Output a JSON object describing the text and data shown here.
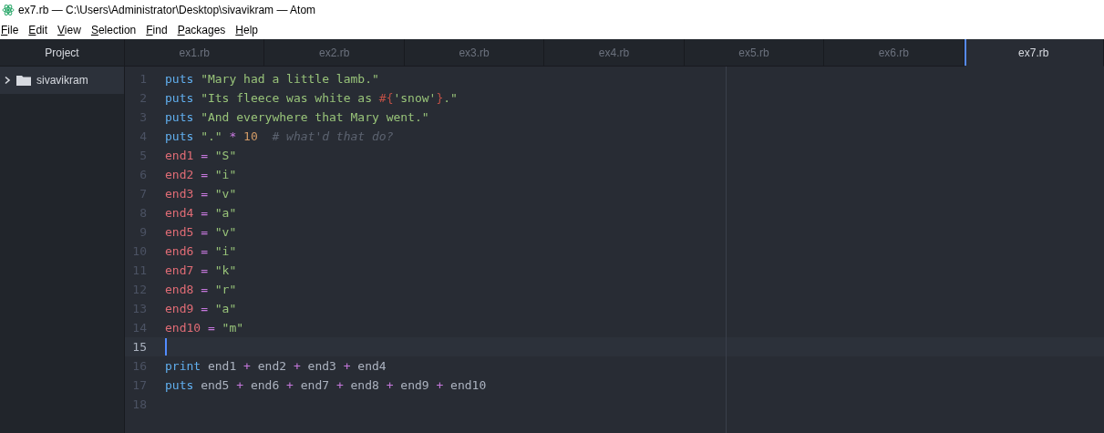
{
  "window": {
    "title": "ex7.rb — C:\\Users\\Administrator\\Desktop\\sivavikram — Atom"
  },
  "menu": [
    "File",
    "Edit",
    "View",
    "Selection",
    "Find",
    "Packages",
    "Help"
  ],
  "sidebar": {
    "title": "Project",
    "items": [
      {
        "label": "sivavikram",
        "expanded": false,
        "selected": true
      }
    ]
  },
  "tabs": [
    {
      "label": "ex1.rb",
      "selected": false
    },
    {
      "label": "ex2.rb",
      "selected": false
    },
    {
      "label": "ex3.rb",
      "selected": false
    },
    {
      "label": "ex4.rb",
      "selected": false
    },
    {
      "label": "ex5.rb",
      "selected": false
    },
    {
      "label": "ex6.rb",
      "selected": false
    },
    {
      "label": "ex7.rb",
      "selected": true
    }
  ],
  "editor": {
    "lines": [
      {
        "number": "1",
        "current": false,
        "tokens": [
          {
            "kind": "keyword",
            "text": "puts"
          },
          {
            "kind": "string",
            "text": " \"Mary had a little lamb.\""
          }
        ]
      },
      {
        "number": "2",
        "current": false,
        "tokens": [
          {
            "kind": "keyword",
            "text": "puts"
          },
          {
            "kind": "string",
            "text": " \"Its fleece was white as "
          },
          {
            "kind": "interp",
            "text": "#{"
          },
          {
            "kind": "string",
            "text": "'snow'"
          },
          {
            "kind": "interp",
            "text": "}"
          },
          {
            "kind": "string",
            "text": ".\""
          }
        ]
      },
      {
        "number": "3",
        "current": false,
        "tokens": [
          {
            "kind": "keyword",
            "text": "puts"
          },
          {
            "kind": "string",
            "text": " \"And everywhere that Mary went.\""
          }
        ]
      },
      {
        "number": "4",
        "current": false,
        "tokens": [
          {
            "kind": "keyword",
            "text": "puts"
          },
          {
            "kind": "string",
            "text": " \".\""
          },
          {
            "kind": "operator",
            "text": " *"
          },
          {
            "kind": "number",
            "text": " 10"
          },
          {
            "kind": "comment",
            "text": "  # what'd that do?"
          }
        ]
      },
      {
        "number": "5",
        "current": false,
        "tokens": [
          {
            "kind": "variable",
            "text": "end1"
          },
          {
            "kind": "operator",
            "text": " ="
          },
          {
            "kind": "string",
            "text": " \"S\""
          }
        ]
      },
      {
        "number": "6",
        "current": false,
        "tokens": [
          {
            "kind": "variable",
            "text": "end2"
          },
          {
            "kind": "operator",
            "text": " ="
          },
          {
            "kind": "string",
            "text": " \"i\""
          }
        ]
      },
      {
        "number": "7",
        "current": false,
        "tokens": [
          {
            "kind": "variable",
            "text": "end3"
          },
          {
            "kind": "operator",
            "text": " ="
          },
          {
            "kind": "string",
            "text": " \"v\""
          }
        ]
      },
      {
        "number": "8",
        "current": false,
        "tokens": [
          {
            "kind": "variable",
            "text": "end4"
          },
          {
            "kind": "operator",
            "text": " ="
          },
          {
            "kind": "string",
            "text": " \"a\""
          }
        ]
      },
      {
        "number": "9",
        "current": false,
        "tokens": [
          {
            "kind": "variable",
            "text": "end5"
          },
          {
            "kind": "operator",
            "text": " ="
          },
          {
            "kind": "string",
            "text": " \"v\""
          }
        ]
      },
      {
        "number": "10",
        "current": false,
        "tokens": [
          {
            "kind": "variable",
            "text": "end6"
          },
          {
            "kind": "operator",
            "text": " ="
          },
          {
            "kind": "string",
            "text": " \"i\""
          }
        ]
      },
      {
        "number": "11",
        "current": false,
        "tokens": [
          {
            "kind": "variable",
            "text": "end7"
          },
          {
            "kind": "operator",
            "text": " ="
          },
          {
            "kind": "string",
            "text": " \"k\""
          }
        ]
      },
      {
        "number": "12",
        "current": false,
        "tokens": [
          {
            "kind": "variable",
            "text": "end8"
          },
          {
            "kind": "operator",
            "text": " ="
          },
          {
            "kind": "string",
            "text": " \"r\""
          }
        ]
      },
      {
        "number": "13",
        "current": false,
        "tokens": [
          {
            "kind": "variable",
            "text": "end9"
          },
          {
            "kind": "operator",
            "text": " ="
          },
          {
            "kind": "string",
            "text": " \"a\""
          }
        ]
      },
      {
        "number": "14",
        "current": false,
        "tokens": [
          {
            "kind": "variable",
            "text": "end10"
          },
          {
            "kind": "operator",
            "text": " ="
          },
          {
            "kind": "string",
            "text": " \"m\""
          }
        ]
      },
      {
        "number": "15",
        "current": true
      },
      {
        "number": "16",
        "current": false,
        "tokens": [
          {
            "kind": "keyword",
            "text": "print"
          },
          {
            "kind": "plain",
            "text": " end1 "
          },
          {
            "kind": "operator",
            "text": "+"
          },
          {
            "kind": "plain",
            "text": " end2 "
          },
          {
            "kind": "operator",
            "text": "+"
          },
          {
            "kind": "plain",
            "text": " end3 "
          },
          {
            "kind": "operator",
            "text": "+"
          },
          {
            "kind": "plain",
            "text": " end4"
          }
        ]
      },
      {
        "number": "17",
        "current": false,
        "tokens": [
          {
            "kind": "keyword",
            "text": "puts"
          },
          {
            "kind": "plain",
            "text": " end5 "
          },
          {
            "kind": "operator",
            "text": "+"
          },
          {
            "kind": "plain",
            "text": " end6 "
          },
          {
            "kind": "operator",
            "text": "+"
          },
          {
            "kind": "plain",
            "text": " end7 "
          },
          {
            "kind": "operator",
            "text": "+"
          },
          {
            "kind": "plain",
            "text": " end8 "
          },
          {
            "kind": "operator",
            "text": "+"
          },
          {
            "kind": "plain",
            "text": " end9 "
          },
          {
            "kind": "operator",
            "text": "+"
          },
          {
            "kind": "plain",
            "text": " end10"
          }
        ]
      },
      {
        "number": "18",
        "current": false
      }
    ]
  }
}
